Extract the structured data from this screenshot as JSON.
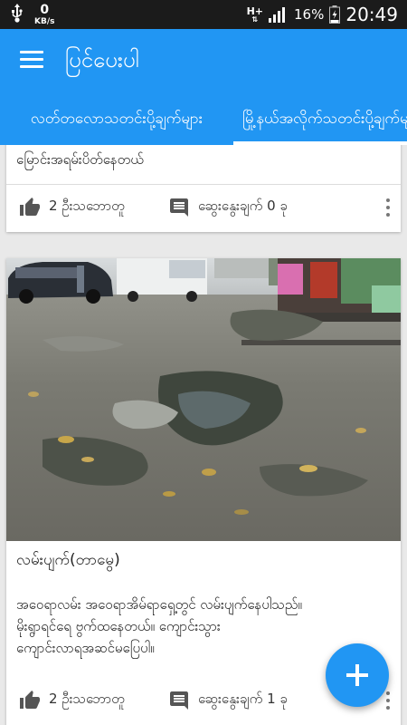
{
  "status_bar": {
    "usb_icon": "usb-icon",
    "net_speed_value": "0",
    "net_speed_unit": "KB/s",
    "network_type": "H+",
    "battery_percent": "16%",
    "time": "20:49"
  },
  "app_bar": {
    "menu_icon": "hamburger-menu-icon",
    "title": "ပြင်ပေးပါ"
  },
  "tabs": [
    {
      "label": "လတ်တလောသတင်းပို့ချက်များ",
      "selected": false
    },
    {
      "label": "မြို့နယ်အလိုက်သတင်းပို့ချက်များ",
      "selected": true
    }
  ],
  "colors": {
    "primary": "#2196f3",
    "status_bar": "#1b1b1b",
    "background": "#e9e9e9"
  },
  "posts": [
    {
      "description": "မြောင်းအရမ်းပိတ်နေတယ်",
      "likes_text": "2 ဦးသဘောတူ",
      "comments_text": "ဆွေးနွေးချက် 0 ခု"
    },
    {
      "image_icon": "flooded-street-photo",
      "title": "လမ်းပျက်(တာမွေ)",
      "description_lines": [
        "အဝေရာလမ်း အဝေရာအိမ်ရာရှေ့တွင် လမ်းပျက်နေပါသည်။",
        "မိုးရွာရင်ရေ ဗွက်ထနေတယ်။ ကျောင်းသွား",
        "ကျောင်းလာရအဆင်မပြေပါ။"
      ],
      "likes_text": "2 ဦးသဘောတူ",
      "comments_text": "ဆွေးနွေးချက် 1 ခု"
    }
  ],
  "fab": {
    "icon": "plus-icon"
  }
}
